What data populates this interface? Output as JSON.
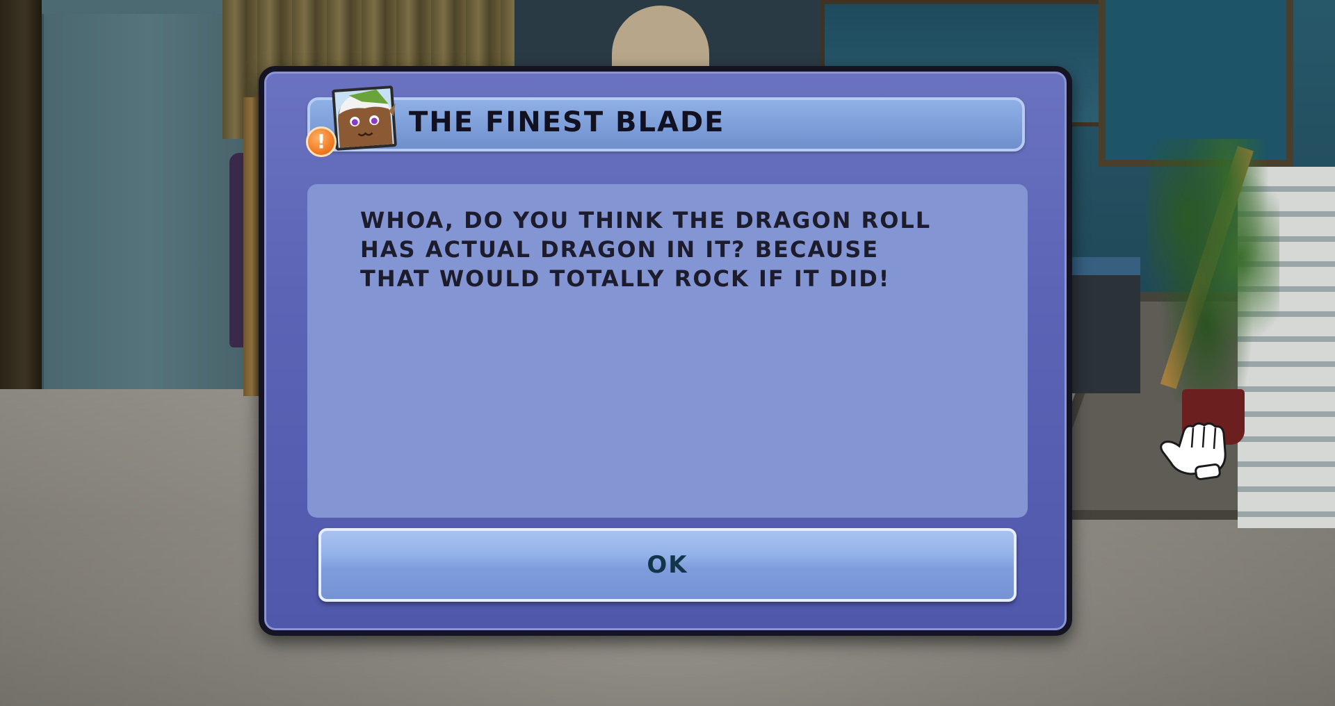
{
  "dialog": {
    "title": "THE FINEST BLADE",
    "message": "WHOA, DO YOU THINK THE DRAGON ROLL\nHAS ACTUAL DRAGON IN IT? BECAUSE\nTHAT WOULD TOTALLY ROCK IF IT DID!",
    "ok_label": "OK",
    "alert_glyph": "!",
    "portrait_icon": "character-portrait-icon",
    "alert_icon": "exclamation-alert-icon"
  },
  "colors": {
    "frame": "#5c64b6",
    "title_bar": "#7d9ed8",
    "message_panel": "#8495d4",
    "button": "#94b2ea",
    "alert_badge": "#f07d24"
  },
  "cursor": {
    "icon": "white-glove-cursor-icon"
  }
}
